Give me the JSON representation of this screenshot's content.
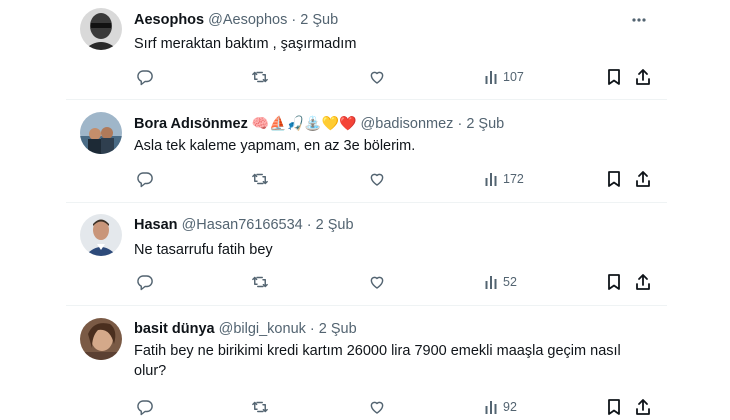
{
  "tweets": [
    {
      "name": "Aesophos",
      "emojis": "",
      "handle": "@Aesophos",
      "dot": "·",
      "date": "2 Şub",
      "text": "Sırf meraktan baktım , şaşırmadım",
      "views": "107"
    },
    {
      "name": "Bora Adısönmez",
      "emojis": "🧠⛵🎣⛲💛❤️",
      "handle": "@badisonmez",
      "dot": "·",
      "date": "2 Şub",
      "text": "Asla tek kaleme yapmam, en az 3e bölerim.",
      "views": "172"
    },
    {
      "name": "Hasan",
      "emojis": "",
      "handle": "@Hasan76166534",
      "dot": "·",
      "date": "2 Şub",
      "text": "Ne tasarrufu fatih bey",
      "views": "52"
    },
    {
      "name": "basit dünya",
      "emojis": "",
      "handle": "@bilgi_konuk",
      "dot": "·",
      "date": "2 Şub",
      "text": "Fatih bey ne birikimi kredi kartım 26000 lira 7900 emekli maaşla geçim nasıl olur?",
      "views": "92"
    }
  ],
  "icons": {
    "reply": "reply-icon",
    "retweet": "retweet-icon",
    "like": "like-icon",
    "views": "views-icon",
    "bookmark": "bookmark-icon",
    "share": "share-icon",
    "more": "more-icon"
  },
  "colors": {
    "text": "#0f1419",
    "secondary": "#536471",
    "divider": "#eff3f4"
  }
}
